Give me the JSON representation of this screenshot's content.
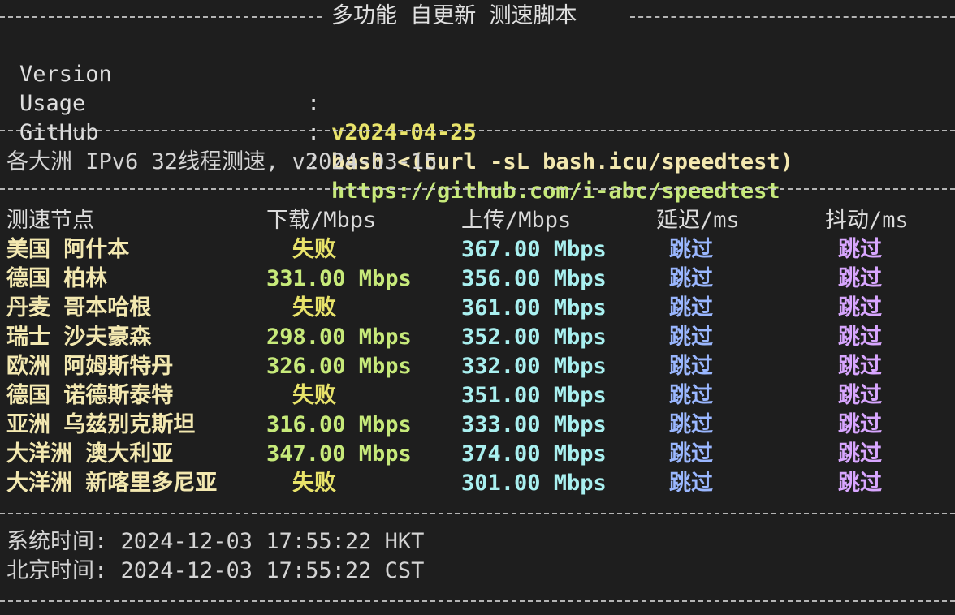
{
  "title": "多功能 自更新 测速脚本",
  "info": {
    "version_key": "Version",
    "version_val": "v2024-04-25",
    "usage_key": "Usage",
    "usage_val": "bash <(curl -sL bash.icu/speedtest)",
    "github_key": "GitHub",
    "github_val": "https://github.com/i-abc/speedtest",
    "sep": ":"
  },
  "subtitle": "各大洲 IPv6 32线程测速, v2024-03-15",
  "table": {
    "headers": [
      "测速节点",
      "下载/Mbps",
      "上传/Mbps",
      "延迟/ms",
      "抖动/ms"
    ],
    "rows": [
      {
        "node": "美国 阿什本",
        "down": "失败",
        "up": "367.00 Mbps",
        "lat": "跳过",
        "jit": "跳过"
      },
      {
        "node": "德国 柏林",
        "down": "331.00 Mbps",
        "up": "356.00 Mbps",
        "lat": "跳过",
        "jit": "跳过"
      },
      {
        "node": "丹麦 哥本哈根",
        "down": "失败",
        "up": "361.00 Mbps",
        "lat": "跳过",
        "jit": "跳过"
      },
      {
        "node": "瑞士 沙夫豪森",
        "down": "298.00 Mbps",
        "up": "352.00 Mbps",
        "lat": "跳过",
        "jit": "跳过"
      },
      {
        "node": "欧洲 阿姆斯特丹",
        "down": "326.00 Mbps",
        "up": "332.00 Mbps",
        "lat": "跳过",
        "jit": "跳过"
      },
      {
        "node": "德国 诺德斯泰特",
        "down": "失败",
        "up": "351.00 Mbps",
        "lat": "跳过",
        "jit": "跳过"
      },
      {
        "node": "亚洲 乌兹别克斯坦",
        "down": "316.00 Mbps",
        "up": "333.00 Mbps",
        "lat": "跳过",
        "jit": "跳过"
      },
      {
        "node": "大洋洲 澳大利亚",
        "down": "347.00 Mbps",
        "up": "374.00 Mbps",
        "lat": "跳过",
        "jit": "跳过"
      },
      {
        "node": "大洋洲 新喀里多尼亚",
        "down": "失败",
        "up": "301.00 Mbps",
        "lat": "跳过",
        "jit": "跳过"
      }
    ]
  },
  "footer": {
    "system_time": "系统时间: 2024-12-03 17:55:22 HKT",
    "beijing_time": "北京时间: 2024-12-03 17:55:22 CST"
  }
}
